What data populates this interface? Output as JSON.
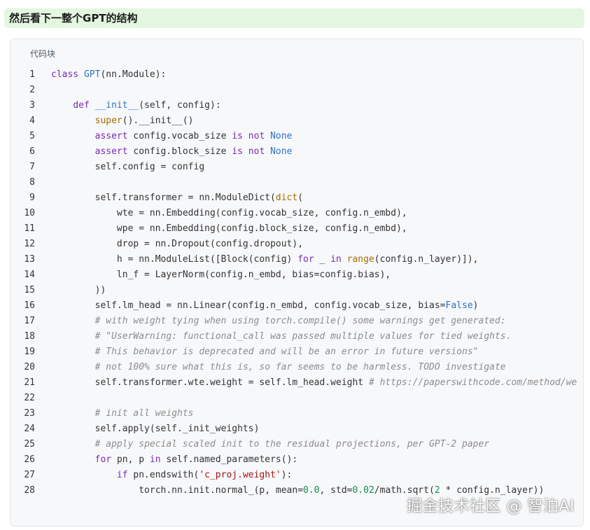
{
  "heading": "然后看下一整个GPT的结构",
  "code_block": {
    "label": "代码块",
    "lines": [
      [
        [
          "kw",
          "class "
        ],
        [
          "cls",
          "GPT"
        ],
        [
          "t",
          "(nn.Module):"
        ]
      ],
      [],
      [
        [
          "t",
          "    "
        ],
        [
          "kw",
          "def "
        ],
        [
          "fn",
          "__init__"
        ],
        [
          "t",
          "(self, config):"
        ]
      ],
      [
        [
          "t",
          "        "
        ],
        [
          "bi",
          "super"
        ],
        [
          "t",
          "().__init__()"
        ]
      ],
      [
        [
          "t",
          "        "
        ],
        [
          "kw",
          "assert "
        ],
        [
          "t",
          "config.vocab_size "
        ],
        [
          "kw",
          "is not "
        ],
        [
          "fn",
          "None"
        ]
      ],
      [
        [
          "t",
          "        "
        ],
        [
          "kw",
          "assert "
        ],
        [
          "t",
          "config.block_size "
        ],
        [
          "kw",
          "is not "
        ],
        [
          "fn",
          "None"
        ]
      ],
      [
        [
          "t",
          "        self.config = config"
        ]
      ],
      [],
      [
        [
          "t",
          "        self.transformer = nn.ModuleDict("
        ],
        [
          "bi",
          "dict"
        ],
        [
          "t",
          "("
        ]
      ],
      [
        [
          "t",
          "            wte = nn.Embedding(config.vocab_size, config.n_embd),"
        ]
      ],
      [
        [
          "t",
          "            wpe = nn.Embedding(config.block_size, config.n_embd),"
        ]
      ],
      [
        [
          "t",
          "            drop = nn.Dropout(config.dropout),"
        ]
      ],
      [
        [
          "t",
          "            h = nn.ModuleList([Block(config) "
        ],
        [
          "kw",
          "for "
        ],
        [
          "t",
          "_ "
        ],
        [
          "kw",
          "in "
        ],
        [
          "bi",
          "range"
        ],
        [
          "t",
          "(config.n_layer)]),"
        ]
      ],
      [
        [
          "t",
          "            ln_f = LayerNorm(config.n_embd, bias=config.bias),"
        ]
      ],
      [
        [
          "t",
          "        ))"
        ]
      ],
      [
        [
          "t",
          "        self.lm_head = nn.Linear(config.n_embd, config.vocab_size, bias="
        ],
        [
          "fn",
          "False"
        ],
        [
          "t",
          ")"
        ]
      ],
      [
        [
          "t",
          "        "
        ],
        [
          "cm",
          "# with weight tying when using torch.compile() some warnings get generated:"
        ]
      ],
      [
        [
          "t",
          "        "
        ],
        [
          "cm",
          "# \"UserWarning: functional_call was passed multiple values for tied weights."
        ]
      ],
      [
        [
          "t",
          "        "
        ],
        [
          "cm",
          "# This behavior is deprecated and will be an error in future versions\""
        ]
      ],
      [
        [
          "t",
          "        "
        ],
        [
          "cm",
          "# not 100% sure what this is, so far seems to be harmless. TODO investigate"
        ]
      ],
      [
        [
          "t",
          "        self.transformer.wte.weight = self.lm_head.weight "
        ],
        [
          "cm",
          "# https://paperswithcode.com/method/we"
        ]
      ],
      [],
      [
        [
          "t",
          "        "
        ],
        [
          "cm",
          "# init all weights"
        ]
      ],
      [
        [
          "t",
          "        self.apply(self._init_weights)"
        ]
      ],
      [
        [
          "t",
          "        "
        ],
        [
          "cm",
          "# apply special scaled init to the residual projections, per GPT-2 paper"
        ]
      ],
      [
        [
          "t",
          "        "
        ],
        [
          "kw",
          "for "
        ],
        [
          "t",
          "pn, p "
        ],
        [
          "kw",
          "in "
        ],
        [
          "t",
          "self.named_parameters():"
        ]
      ],
      [
        [
          "t",
          "            "
        ],
        [
          "kw",
          "if "
        ],
        [
          "t",
          "pn.endswith("
        ],
        [
          "str",
          "'c_proj.weight'"
        ],
        [
          "t",
          "):"
        ]
      ],
      [
        [
          "t",
          "                torch.nn.init.normal_(p, mean="
        ],
        [
          "num",
          "0.0"
        ],
        [
          "t",
          ", std="
        ],
        [
          "num",
          "0.02"
        ],
        [
          "t",
          "/math.sqrt("
        ],
        [
          "num",
          "2"
        ],
        [
          "t",
          " * config.n_layer))"
        ]
      ]
    ]
  },
  "watermark": "掘金技术社区 @ 智泊AI"
}
